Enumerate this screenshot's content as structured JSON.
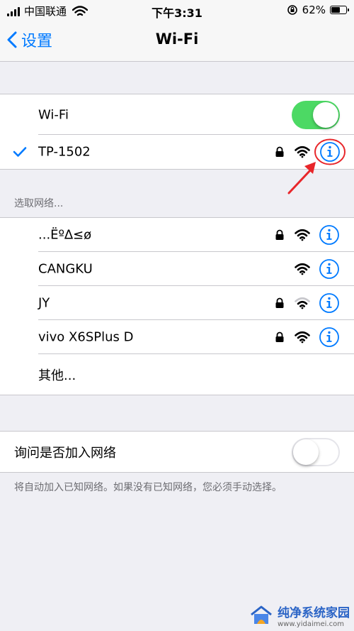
{
  "status_bar": {
    "carrier": "中国联通",
    "time": "下午3:31",
    "battery_percent": "62%",
    "battery_level": 0.62
  },
  "nav": {
    "back_label": "设置",
    "title": "Wi-Fi"
  },
  "wifi_group": {
    "toggle_label": "Wi-Fi",
    "toggle_on": true,
    "connected_network": "TP-1502"
  },
  "choose_network_header": "选取网络...",
  "networks": [
    {
      "name": "...Ëº∆≤ø",
      "locked": true,
      "signal": "full"
    },
    {
      "name": "CANGKU",
      "locked": false,
      "signal": "full"
    },
    {
      "name": "JY",
      "locked": true,
      "signal": "weak"
    },
    {
      "name": "vivo X6SPlus D",
      "locked": true,
      "signal": "full"
    }
  ],
  "other_label": "其他...",
  "ask_join": {
    "label": "询问是否加入网络",
    "toggle_on": false,
    "footer": "将自动加入已知网络。如果没有已知网络，您必须手动选择。"
  },
  "colors": {
    "accent": "#007aff",
    "toggle_on": "#4cd964",
    "highlight": "#e8262a"
  },
  "watermark": {
    "title": "纯净系统家园",
    "url": "www.yidaimei.com"
  }
}
